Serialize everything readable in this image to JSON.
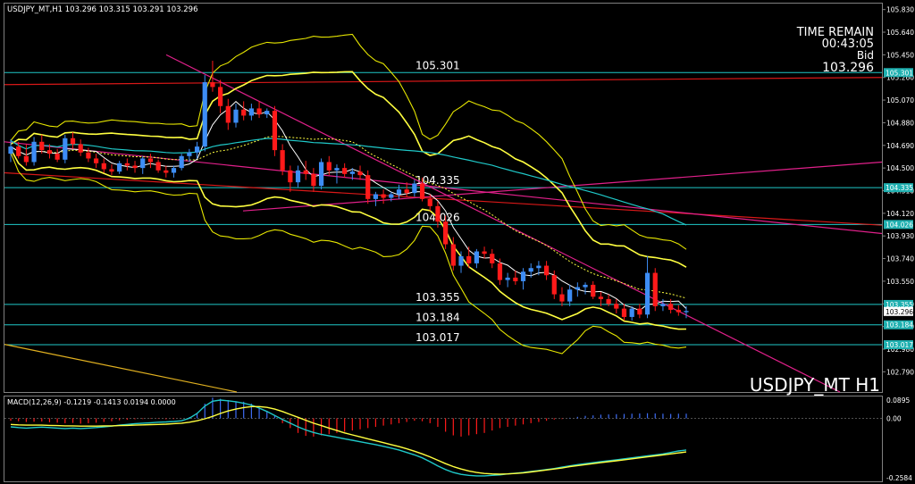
{
  "window": {
    "header_info": "USDJPY_MT,H1  103.296 103.315 103.291 103.296",
    "symbol_label": "USDJPY_MT H1"
  },
  "timer": {
    "title": "TIME REMAIN",
    "value": "00:43:05",
    "bid_label": "Bid",
    "bid_value": "103.296"
  },
  "macd": {
    "header": "MACD(12,26,9) -0.1219 -0.1413 0.0194 0.0000",
    "ticks": [
      "0.0895",
      "0.00",
      "-0.2584"
    ]
  },
  "levels": [
    {
      "name": "105.301",
      "label": "105.301",
      "tag": "105.301",
      "value": 105.301,
      "label_shown": true
    },
    {
      "name": "104.335",
      "label": "104.335",
      "tag": "104.335",
      "value": 104.335,
      "label_shown": true
    },
    {
      "name": "104.026",
      "label": "104.026",
      "tag": "104.026",
      "value": 104.026,
      "label_shown": true
    },
    {
      "name": "103.355",
      "label": "103.355",
      "tag": "103.355",
      "value": 103.355,
      "label_shown": true
    },
    {
      "name": "103.184",
      "label": "103.184",
      "tag": "103.184",
      "value": 103.184,
      "label_shown": true
    },
    {
      "name": "103.017",
      "label": "103.017",
      "tag": "103.017",
      "value": 103.017,
      "label_shown": true
    }
  ],
  "colors": {
    "background": "#000000",
    "bull": "#3d8df5",
    "bear": "#ff1a1a",
    "level_line": "#1fc8c8",
    "bollinger": "#ffff40",
    "bollinger_outer": "#e6e600",
    "ma_fast": "#ffffff",
    "ma_slow": "#1fc8c8",
    "trend_magenta": "#e0208a",
    "trend_red": "#d81818",
    "macd_signal": "#ffff40",
    "macd_line": "#1fc8c8",
    "hist_pos": "#3d6cf5",
    "hist_neg": "#ff1a1a",
    "tag_bg": "#1fb0b0",
    "price_tag_bg": "#ffffff"
  },
  "chart_data": {
    "type": "candlestick",
    "symbol": "USDJPY_MT",
    "timeframe": "H1",
    "ylim": [
      102.62,
      105.88
    ],
    "y_ticks": [
      105.83,
      105.64,
      105.45,
      105.26,
      105.07,
      104.88,
      104.69,
      104.5,
      104.31,
      104.12,
      103.93,
      103.74,
      103.55,
      103.36,
      103.17,
      102.98,
      102.79
    ],
    "current_price": 103.296,
    "current_price_label": "103.296",
    "candles_ohlc": [
      [
        104.62,
        104.74,
        104.55,
        104.68
      ],
      [
        104.68,
        104.72,
        104.58,
        104.6
      ],
      [
        104.6,
        104.7,
        104.52,
        104.55
      ],
      [
        104.55,
        104.76,
        104.52,
        104.72
      ],
      [
        104.72,
        104.78,
        104.62,
        104.65
      ],
      [
        104.65,
        104.7,
        104.58,
        104.62
      ],
      [
        104.62,
        104.66,
        104.55,
        104.57
      ],
      [
        104.57,
        104.78,
        104.54,
        104.75
      ],
      [
        104.75,
        104.8,
        104.66,
        104.7
      ],
      [
        104.7,
        104.74,
        104.6,
        104.63
      ],
      [
        104.63,
        104.67,
        104.55,
        104.58
      ],
      [
        104.58,
        104.62,
        104.5,
        104.54
      ],
      [
        104.54,
        104.58,
        104.46,
        104.49
      ],
      [
        104.49,
        104.53,
        104.44,
        104.47
      ],
      [
        104.47,
        104.56,
        104.45,
        104.54
      ],
      [
        104.54,
        104.58,
        104.48,
        104.52
      ],
      [
        104.52,
        104.56,
        104.46,
        104.5
      ],
      [
        104.5,
        104.6,
        104.45,
        104.58
      ],
      [
        104.58,
        104.62,
        104.5,
        104.55
      ],
      [
        104.55,
        104.57,
        104.46,
        104.48
      ],
      [
        104.48,
        104.52,
        104.42,
        104.46
      ],
      [
        104.46,
        104.52,
        104.42,
        104.5
      ],
      [
        104.5,
        104.62,
        104.48,
        104.6
      ],
      [
        104.6,
        104.66,
        104.55,
        104.63
      ],
      [
        104.63,
        104.72,
        104.58,
        104.68
      ],
      [
        104.68,
        105.28,
        104.64,
        105.22
      ],
      [
        105.22,
        105.4,
        105.14,
        105.18
      ],
      [
        105.18,
        105.24,
        104.96,
        105.02
      ],
      [
        105.02,
        105.08,
        104.82,
        104.88
      ],
      [
        104.88,
        105.04,
        104.84,
        104.99
      ],
      [
        104.99,
        105.06,
        104.9,
        104.94
      ],
      [
        104.94,
        105.04,
        104.9,
        105.0
      ],
      [
        105.0,
        105.06,
        104.92,
        104.95
      ],
      [
        104.95,
        105.0,
        104.92,
        104.98
      ],
      [
        104.98,
        105.02,
        104.6,
        104.65
      ],
      [
        104.65,
        104.7,
        104.44,
        104.48
      ],
      [
        104.48,
        104.52,
        104.3,
        104.38
      ],
      [
        104.38,
        104.52,
        104.34,
        104.48
      ],
      [
        104.48,
        104.56,
        104.4,
        104.45
      ],
      [
        104.45,
        104.5,
        104.3,
        104.35
      ],
      [
        104.35,
        104.58,
        104.32,
        104.55
      ],
      [
        104.55,
        104.6,
        104.44,
        104.48
      ],
      [
        104.48,
        104.53,
        104.37,
        104.5
      ],
      [
        104.5,
        104.54,
        104.42,
        104.45
      ],
      [
        104.45,
        104.5,
        104.4,
        104.47
      ],
      [
        104.47,
        104.52,
        104.4,
        104.44
      ],
      [
        104.44,
        104.48,
        104.2,
        104.24
      ],
      [
        104.24,
        104.3,
        104.18,
        104.28
      ],
      [
        104.28,
        104.32,
        104.2,
        104.25
      ],
      [
        104.25,
        104.3,
        104.22,
        104.28
      ],
      [
        104.28,
        104.36,
        104.24,
        104.32
      ],
      [
        104.32,
        104.38,
        104.26,
        104.29
      ],
      [
        104.29,
        104.4,
        104.26,
        104.37
      ],
      [
        104.37,
        104.42,
        104.22,
        104.24
      ],
      [
        104.24,
        104.28,
        104.14,
        104.18
      ],
      [
        104.18,
        104.22,
        104.0,
        104.05
      ],
      [
        104.05,
        104.1,
        103.82,
        103.86
      ],
      [
        103.86,
        103.92,
        103.64,
        103.68
      ],
      [
        103.68,
        103.8,
        103.62,
        103.76
      ],
      [
        103.76,
        103.84,
        103.66,
        103.7
      ],
      [
        103.7,
        103.82,
        103.66,
        103.8
      ],
      [
        103.8,
        103.84,
        103.74,
        103.78
      ],
      [
        103.78,
        103.82,
        103.66,
        103.7
      ],
      [
        103.7,
        103.74,
        103.52,
        103.56
      ],
      [
        103.56,
        103.62,
        103.5,
        103.58
      ],
      [
        103.58,
        103.64,
        103.52,
        103.55
      ],
      [
        103.55,
        103.66,
        103.48,
        103.63
      ],
      [
        103.63,
        103.7,
        103.58,
        103.66
      ],
      [
        103.66,
        103.72,
        103.6,
        103.68
      ],
      [
        103.68,
        103.72,
        103.56,
        103.6
      ],
      [
        103.6,
        103.64,
        103.4,
        103.44
      ],
      [
        103.44,
        103.5,
        103.34,
        103.38
      ],
      [
        103.38,
        103.52,
        103.34,
        103.48
      ],
      [
        103.48,
        103.54,
        103.42,
        103.5
      ],
      [
        103.5,
        103.54,
        103.44,
        103.52
      ],
      [
        103.52,
        103.55,
        103.4,
        103.42
      ],
      [
        103.42,
        103.46,
        103.34,
        103.4
      ],
      [
        103.4,
        103.44,
        103.34,
        103.36
      ],
      [
        103.36,
        103.4,
        103.28,
        103.32
      ],
      [
        103.32,
        103.36,
        103.22,
        103.25
      ],
      [
        103.25,
        103.34,
        103.22,
        103.32
      ],
      [
        103.32,
        103.36,
        103.24,
        103.27
      ],
      [
        103.27,
        103.76,
        103.24,
        103.62
      ],
      [
        103.62,
        103.66,
        103.3,
        103.34
      ],
      [
        103.34,
        103.4,
        103.3,
        103.36
      ],
      [
        103.36,
        103.4,
        103.28,
        103.31
      ],
      [
        103.31,
        103.35,
        103.26,
        103.29
      ],
      [
        103.29,
        103.34,
        103.24,
        103.3
      ]
    ],
    "macd_values": {
      "ylim": [
        -0.2584,
        0.0895
      ],
      "histogram": [
        -0.01,
        -0.012,
        -0.015,
        -0.014,
        -0.013,
        -0.016,
        -0.018,
        -0.02,
        -0.019,
        -0.022,
        -0.02,
        -0.018,
        -0.015,
        -0.012,
        -0.008,
        -0.006,
        -0.004,
        -0.003,
        -0.002,
        -0.002,
        -0.004,
        -0.003,
        -0.001,
        0.005,
        0.02,
        0.06,
        0.085,
        0.08,
        0.075,
        0.07,
        0.068,
        0.06,
        0.045,
        0.03,
        0.01,
        -0.02,
        -0.04,
        -0.06,
        -0.072,
        -0.075,
        -0.07,
        -0.065,
        -0.06,
        -0.055,
        -0.05,
        -0.045,
        -0.04,
        -0.035,
        -0.03,
        -0.025,
        -0.02,
        -0.015,
        -0.01,
        -0.012,
        -0.02,
        -0.035,
        -0.055,
        -0.07,
        -0.075,
        -0.07,
        -0.065,
        -0.06,
        -0.05,
        -0.04,
        -0.035,
        -0.03,
        -0.025,
        -0.02,
        -0.015,
        -0.01,
        -0.005,
        -0.003,
        0.002,
        0.006,
        0.01,
        0.012,
        0.015,
        0.016,
        0.017,
        0.018,
        0.019,
        0.02,
        0.021,
        0.02,
        0.019,
        0.018,
        0.019,
        0.019
      ],
      "macd": [
        -0.035,
        -0.038,
        -0.04,
        -0.038,
        -0.036,
        -0.038,
        -0.04,
        -0.042,
        -0.04,
        -0.042,
        -0.04,
        -0.038,
        -0.035,
        -0.032,
        -0.028,
        -0.025,
        -0.022,
        -0.02,
        -0.018,
        -0.016,
        -0.015,
        -0.013,
        -0.01,
        0.0,
        0.02,
        0.05,
        0.07,
        0.075,
        0.072,
        0.068,
        0.062,
        0.054,
        0.042,
        0.028,
        0.012,
        -0.005,
        -0.02,
        -0.035,
        -0.048,
        -0.058,
        -0.066,
        -0.072,
        -0.078,
        -0.084,
        -0.09,
        -0.096,
        -0.102,
        -0.108,
        -0.115,
        -0.122,
        -0.13,
        -0.14,
        -0.15,
        -0.162,
        -0.178,
        -0.195,
        -0.21,
        -0.222,
        -0.23,
        -0.234,
        -0.236,
        -0.236,
        -0.234,
        -0.232,
        -0.228,
        -0.225,
        -0.222,
        -0.218,
        -0.214,
        -0.21,
        -0.206,
        -0.2,
        -0.195,
        -0.19,
        -0.186,
        -0.182,
        -0.178,
        -0.174,
        -0.17,
        -0.166,
        -0.162,
        -0.158,
        -0.154,
        -0.15,
        -0.146,
        -0.14,
        -0.134,
        -0.13
      ],
      "signal": [
        -0.025,
        -0.027,
        -0.028,
        -0.028,
        -0.028,
        -0.029,
        -0.03,
        -0.031,
        -0.031,
        -0.032,
        -0.032,
        -0.032,
        -0.031,
        -0.031,
        -0.03,
        -0.029,
        -0.028,
        -0.027,
        -0.026,
        -0.025,
        -0.024,
        -0.022,
        -0.02,
        -0.016,
        -0.01,
        -0.002,
        0.008,
        0.02,
        0.03,
        0.038,
        0.044,
        0.048,
        0.048,
        0.045,
        0.038,
        0.028,
        0.016,
        0.004,
        -0.008,
        -0.02,
        -0.03,
        -0.04,
        -0.05,
        -0.06,
        -0.068,
        -0.076,
        -0.084,
        -0.092,
        -0.1,
        -0.108,
        -0.116,
        -0.125,
        -0.135,
        -0.146,
        -0.158,
        -0.172,
        -0.186,
        -0.198,
        -0.208,
        -0.216,
        -0.222,
        -0.226,
        -0.228,
        -0.229,
        -0.228,
        -0.226,
        -0.224,
        -0.22,
        -0.216,
        -0.212,
        -0.208,
        -0.204,
        -0.198,
        -0.194,
        -0.19,
        -0.186,
        -0.182,
        -0.178,
        -0.174,
        -0.17,
        -0.166,
        -0.162,
        -0.158,
        -0.154,
        -0.15,
        -0.146,
        -0.142,
        -0.138
      ]
    }
  }
}
